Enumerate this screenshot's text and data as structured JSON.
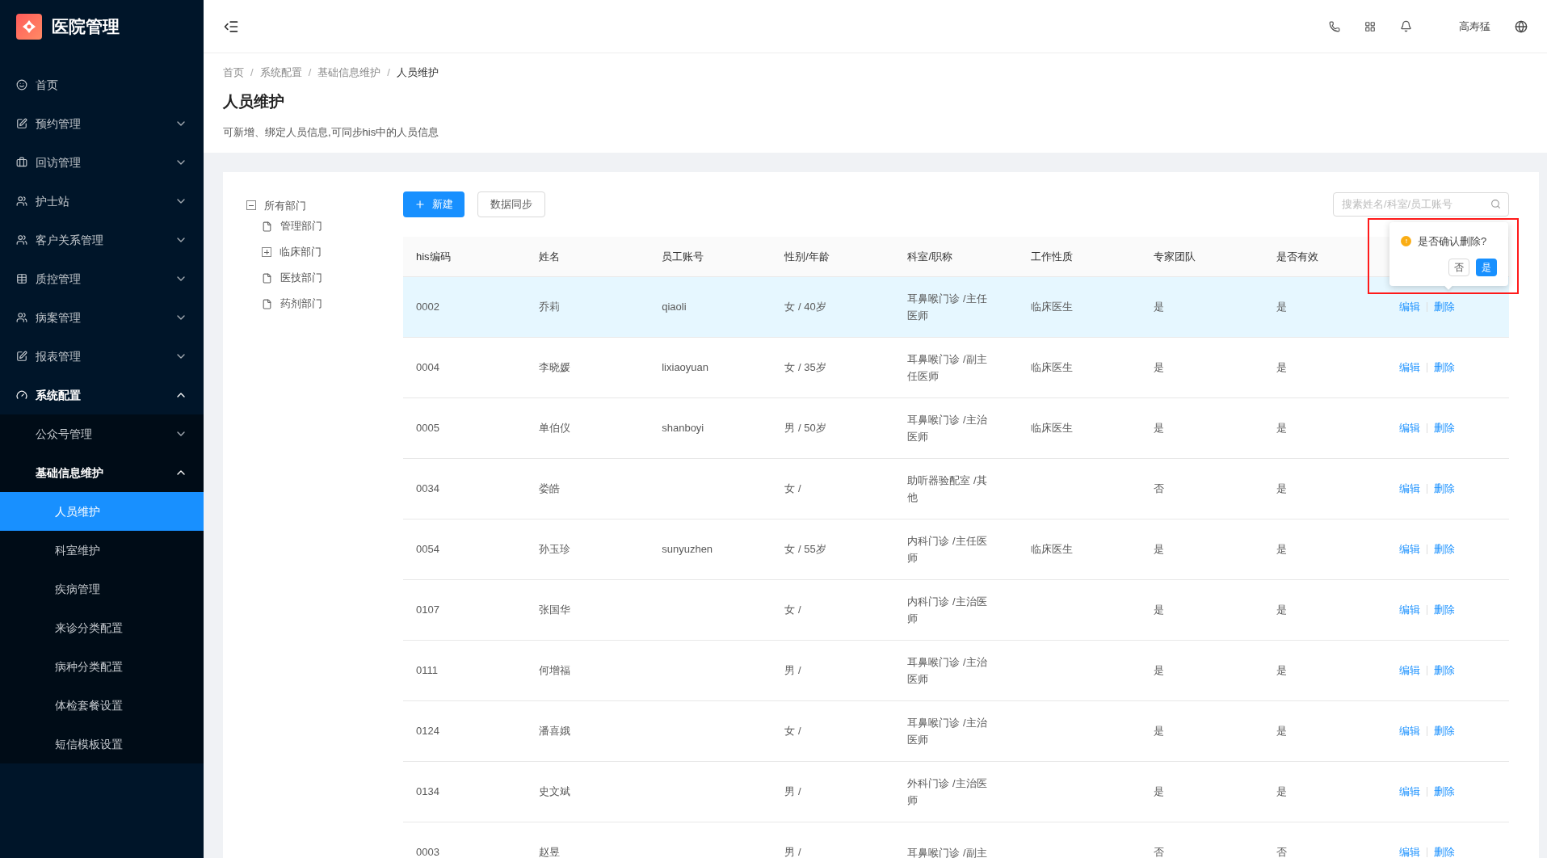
{
  "app": {
    "title": "医院管理"
  },
  "sidebar": {
    "items": [
      {
        "label": "首页",
        "selected": false
      },
      {
        "label": "预约管理",
        "selected": false,
        "expanded": false
      },
      {
        "label": "回访管理",
        "selected": false,
        "expanded": false
      },
      {
        "label": "护士站",
        "selected": false,
        "expanded": false
      },
      {
        "label": "客户关系管理",
        "selected": false,
        "expanded": false
      },
      {
        "label": "质控管理",
        "selected": false,
        "expanded": false
      },
      {
        "label": "病案管理",
        "selected": false,
        "expanded": false
      },
      {
        "label": "报表管理",
        "selected": false,
        "expanded": false
      },
      {
        "label": "系统配置",
        "selected": false,
        "expanded": true,
        "children": [
          {
            "label": "公众号管理",
            "selected": false,
            "expanded": false
          },
          {
            "label": "基础信息维护",
            "selected": false,
            "expanded": true,
            "children": [
              {
                "label": "人员维护",
                "selected": true
              },
              {
                "label": "科室维护",
                "selected": false
              },
              {
                "label": "疾病管理",
                "selected": false
              },
              {
                "label": "来诊分类配置",
                "selected": false
              },
              {
                "label": "病种分类配置",
                "selected": false
              },
              {
                "label": "体检套餐设置",
                "selected": false
              },
              {
                "label": "短信模板设置",
                "selected": false
              }
            ]
          }
        ]
      }
    ]
  },
  "header": {
    "user": "高寿猛"
  },
  "breadcrumb": [
    {
      "kind": "link",
      "text": "首页"
    },
    {
      "kind": "separator",
      "text": "/"
    },
    {
      "kind": "link",
      "text": "系统配置"
    },
    {
      "kind": "separator",
      "text": "/"
    },
    {
      "kind": "link",
      "text": "基础信息维护"
    },
    {
      "kind": "separator",
      "text": "/"
    },
    {
      "kind": "current",
      "text": "人员维护"
    }
  ],
  "page": {
    "title": "人员维护",
    "description": "可新增、绑定人员信息,可同步his中的人员信息"
  },
  "tree": {
    "label": "所有部门",
    "expanded": true,
    "children": [
      {
        "label": "管理部门"
      },
      {
        "label": "临床部门",
        "expanded": false
      },
      {
        "label": "医技部门"
      },
      {
        "label": "药剂部门"
      }
    ]
  },
  "toolbar": {
    "new_button": "新建",
    "sync_button": "数据同步",
    "search": {
      "placeholder": "搜素姓名/科室/员工账号"
    }
  },
  "table": {
    "columns": [
      "his编码",
      "姓名",
      "员工账号",
      "性别/年龄",
      "科室/职称",
      "工作性质",
      "专家团队",
      "是否有效"
    ],
    "rows": [
      {
        "selected": true,
        "cells": [
          "0002",
          "乔莉",
          "qiaoli",
          "女 / 40岁",
          "耳鼻喉门诊 /主任医师",
          "临床医生",
          "是",
          "是"
        ],
        "actions": [
          "编辑",
          "删除"
        ]
      },
      {
        "selected": false,
        "cells": [
          "0004",
          "李晓媛",
          "lixiaoyuan",
          "女 / 35岁",
          "耳鼻喉门诊 /副主任医师",
          "临床医生",
          "是",
          "是"
        ],
        "actions": [
          "编辑",
          "删除"
        ]
      },
      {
        "selected": false,
        "cells": [
          "0005",
          "单伯仪",
          "shanboyi",
          "男 / 50岁",
          "耳鼻喉门诊 /主治医师",
          "临床医生",
          "是",
          "是"
        ],
        "actions": [
          "编辑",
          "删除"
        ]
      },
      {
        "selected": false,
        "cells": [
          "0034",
          "娄皓",
          "",
          "女 /",
          "助听器验配室 /其他",
          "",
          "否",
          "是"
        ],
        "actions": [
          "编辑",
          "删除"
        ]
      },
      {
        "selected": false,
        "cells": [
          "0054",
          "孙玉珍",
          "sunyuzhen",
          "女 / 55岁",
          "内科门诊 /主任医师",
          "临床医生",
          "是",
          "是"
        ],
        "actions": [
          "编辑",
          "删除"
        ]
      },
      {
        "selected": false,
        "cells": [
          "0107",
          "张国华",
          "",
          "女 /",
          "内科门诊 /主治医师",
          "",
          "是",
          "是"
        ],
        "actions": [
          "编辑",
          "删除"
        ]
      },
      {
        "selected": false,
        "cells": [
          "0111",
          "何增福",
          "",
          "男 /",
          "耳鼻喉门诊 /主治医师",
          "",
          "是",
          "是"
        ],
        "actions": [
          "编辑",
          "删除"
        ]
      },
      {
        "selected": false,
        "cells": [
          "0124",
          "潘喜娥",
          "",
          "女 /",
          "耳鼻喉门诊 /主治医师",
          "",
          "是",
          "是"
        ],
        "actions": [
          "编辑",
          "删除"
        ]
      },
      {
        "selected": false,
        "cells": [
          "0134",
          "史文斌",
          "",
          "男 /",
          "外科门诊 /主治医师",
          "",
          "是",
          "是"
        ],
        "actions": [
          "编辑",
          "删除"
        ]
      },
      {
        "selected": false,
        "cells": [
          "0003",
          "赵昱",
          "",
          "男 /",
          "耳鼻喉门诊 /副主",
          "",
          "否",
          "否"
        ],
        "actions": [
          "编辑",
          "删除"
        ]
      }
    ]
  },
  "popconfirm": {
    "message": "是否确认删除?",
    "cancel": "否",
    "confirm": "是"
  }
}
